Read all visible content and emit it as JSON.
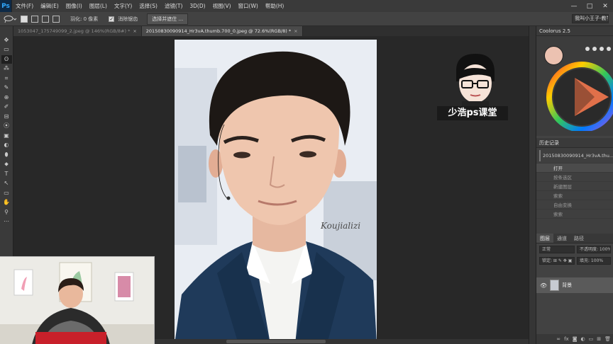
{
  "app": {
    "logo": "Ps"
  },
  "menu": [
    "文件(F)",
    "编辑(E)",
    "图像(I)",
    "图层(L)",
    "文字(Y)",
    "选择(S)",
    "滤镜(T)",
    "3D(D)",
    "视图(V)",
    "窗口(W)",
    "帮助(H)"
  ],
  "window_controls": {
    "minimize": "—",
    "maximize": "□",
    "close": "✕"
  },
  "options": {
    "feather_label": "羽化: 0 像素",
    "antialias_label": "消除锯齿",
    "select_mask_label": "选择并遮住 ...",
    "workspace": "我叫小王子-教学"
  },
  "tabs": [
    {
      "label": "1053047_175749099_2.jpeg @ 146%(RGB/8#) *",
      "close": "×"
    },
    {
      "label": "20150830090914_Hr3vA.thumb.700_0.jpeg @ 72.6%(RGB/8) *",
      "close": "×"
    }
  ],
  "tools": [
    "✥",
    "▭",
    "ʘ",
    "⁂",
    "⌗",
    "✎",
    "⊕",
    "✐",
    "⊟",
    "⦿",
    "▣",
    "◐",
    "⬮",
    "⬥",
    "T",
    "↖",
    "▭",
    "✋",
    "⚲",
    "⋯"
  ],
  "canvas": {
    "signature": "Koujializi"
  },
  "logo": {
    "text": "少浩ps课堂"
  },
  "coolorus": {
    "title": "Coolorus 2.5",
    "color": "#ecc2b1"
  },
  "history": {
    "title": "历史记录",
    "snapshot": "20150830090914_Hr3vA.thu...",
    "items": [
      "打开",
      "按条选区",
      "新建图层",
      "索索",
      "自由变换",
      "索索"
    ]
  },
  "layers": {
    "tabs": [
      "图层",
      "通道",
      "路径"
    ],
    "mode": "正常",
    "opacity": "不透明度: 100%",
    "lock": "锁定: ⊞ ✎ ✥ ▣",
    "fill": "填充: 100%",
    "layer_name": "背景"
  }
}
